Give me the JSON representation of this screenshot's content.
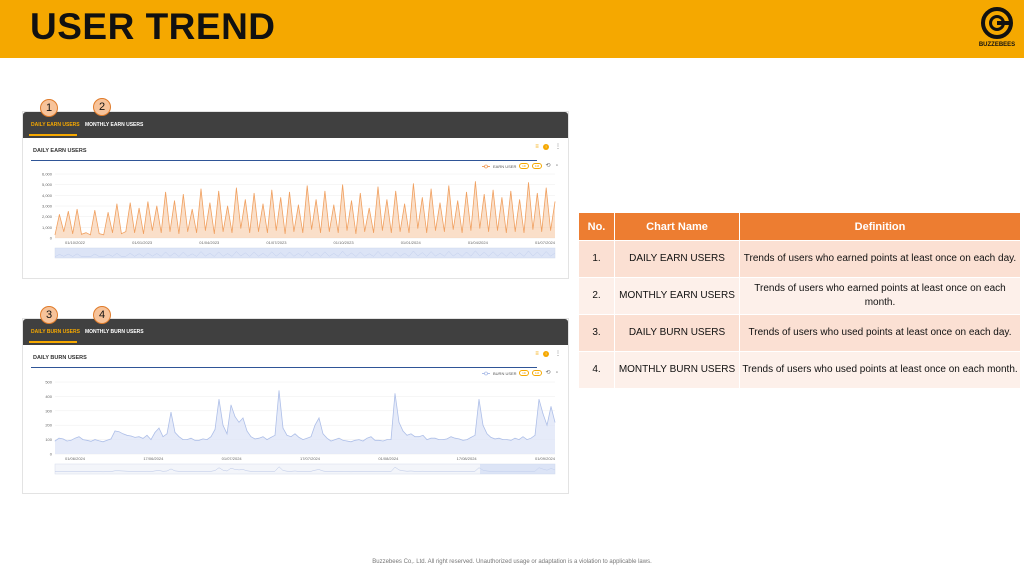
{
  "header": {
    "title": "USER TREND",
    "logo_text": "BUZZEBEES",
    "logo_icon": "buzzebees-logo-icon"
  },
  "callouts": [
    "1",
    "2",
    "3",
    "4"
  ],
  "panel1": {
    "tabs": [
      "DAILY EARN USERS",
      "MONTHLY EARN USERS"
    ],
    "chart_title": "DAILY EARN USERS",
    "legend": "EARN USER",
    "pills": [
      "1D",
      "1M"
    ]
  },
  "panel2": {
    "tabs": [
      "DAILY BURN USERS",
      "MONTHLY BURN USERS"
    ],
    "chart_title": "DAILY BURN USERS",
    "legend": "BURN USER",
    "pills": [
      "1D",
      "1M"
    ]
  },
  "table": {
    "headers": [
      "No.",
      "Chart Name",
      "Definition"
    ],
    "rows": [
      {
        "no": "1.",
        "name": "DAILY  EARN USERS",
        "def": "Trends of users who earned points at least once on each day."
      },
      {
        "no": "2.",
        "name": "MONTHLY  EARN USERS",
        "def": "Trends of users who earned points at least once on each month."
      },
      {
        "no": "3.",
        "name": "DAILY  BURN USERS",
        "def": "Trends of users who used points at least once on each day."
      },
      {
        "no": "4.",
        "name": "MONTHLY  BURN USERS",
        "def": "Trends of users who used points at least once on each month."
      }
    ]
  },
  "footer": "Buzzebees Co,. Ltd. All right reserved. Unauthorized usage or adaptation is a violation to applicable laws.",
  "colors": {
    "header": "#f5a800",
    "earn": "#f0a060",
    "burn": "#aebfe8",
    "table_header": "#ed7d31"
  },
  "chart_data": [
    {
      "type": "area",
      "title": "DAILY EARN USERS",
      "y_ticks": [
        "6,000",
        "5,000",
        "4,000",
        "3,000",
        "2,000",
        "1,000",
        "0"
      ],
      "ylim": [
        0,
        6000
      ],
      "x_ticks": [
        "01/10/2022",
        "01/01/2023",
        "01/04/2023",
        "01/07/2023",
        "01/10/2023",
        "01/01/2024",
        "01/04/2024",
        "01/07/2024"
      ],
      "series": [
        {
          "name": "EARN USER",
          "values": [
            300,
            2200,
            600,
            2500,
            400,
            2700,
            350,
            500,
            300,
            2600,
            400,
            300,
            2400,
            500,
            3200,
            400,
            600,
            3300,
            500,
            2800,
            400,
            3400,
            700,
            3000,
            500,
            4300,
            600,
            3500,
            400,
            4100,
            600,
            2700,
            500,
            4600,
            700,
            3300,
            400,
            4400,
            600,
            3000,
            500,
            4700,
            900,
            3600,
            500,
            4200,
            600,
            3200,
            500,
            4500,
            700,
            3800,
            400,
            4300,
            600,
            3100,
            500,
            4900,
            800,
            3600,
            500,
            4400,
            600,
            3100,
            500,
            5000,
            700,
            3500,
            400,
            4200,
            600,
            2800,
            500,
            4800,
            700,
            3600,
            500,
            4400,
            600,
            3200,
            500,
            5100,
            900,
            3800,
            500,
            4600,
            700,
            3300,
            600,
            4900,
            800,
            3500,
            500,
            4300,
            700,
            5300,
            900,
            4100,
            600,
            4500,
            700,
            3800,
            500,
            4400,
            600,
            3600,
            500,
            5200,
            800,
            4200,
            600,
            4700,
            700,
            3400
          ]
        }
      ]
    },
    {
      "type": "area",
      "title": "DAILY BURN USERS",
      "y_ticks": [
        "500",
        "400",
        "300",
        "200",
        "100",
        "0"
      ],
      "ylim": [
        0,
        500
      ],
      "x_ticks": [
        "01/06/2024",
        "17/06/2024",
        "01/07/2024",
        "17/07/2024",
        "01/08/2024",
        "17/08/2024",
        "01/09/2024"
      ],
      "series": [
        {
          "name": "BURN USER",
          "values": [
            90,
            110,
            105,
            90,
            95,
            110,
            120,
            100,
            95,
            88,
            100,
            92,
            85,
            95,
            105,
            160,
            155,
            140,
            130,
            125,
            115,
            120,
            108,
            130,
            100,
            150,
            180,
            120,
            140,
            290,
            150,
            120,
            100,
            100,
            110,
            95,
            95,
            105,
            100,
            120,
            170,
            380,
            200,
            140,
            340,
            260,
            220,
            250,
            160,
            120,
            105,
            110,
            120,
            100,
            115,
            130,
            440,
            180,
            130,
            120,
            140,
            115,
            100,
            110,
            120,
            200,
            250,
            140,
            110,
            90,
            100,
            110,
            95,
            90,
            85,
            95,
            100,
            90,
            110,
            120,
            95,
            95,
            90,
            100,
            100,
            420,
            220,
            160,
            130,
            140,
            120,
            120,
            130,
            100,
            110,
            110,
            100,
            100,
            105,
            120,
            110,
            105,
            95,
            100,
            115,
            130,
            380,
            200,
            140,
            115,
            105,
            110,
            100,
            100,
            95,
            110,
            100,
            120,
            100,
            110,
            130,
            380,
            280,
            200,
            330,
            220
          ]
        }
      ]
    }
  ]
}
